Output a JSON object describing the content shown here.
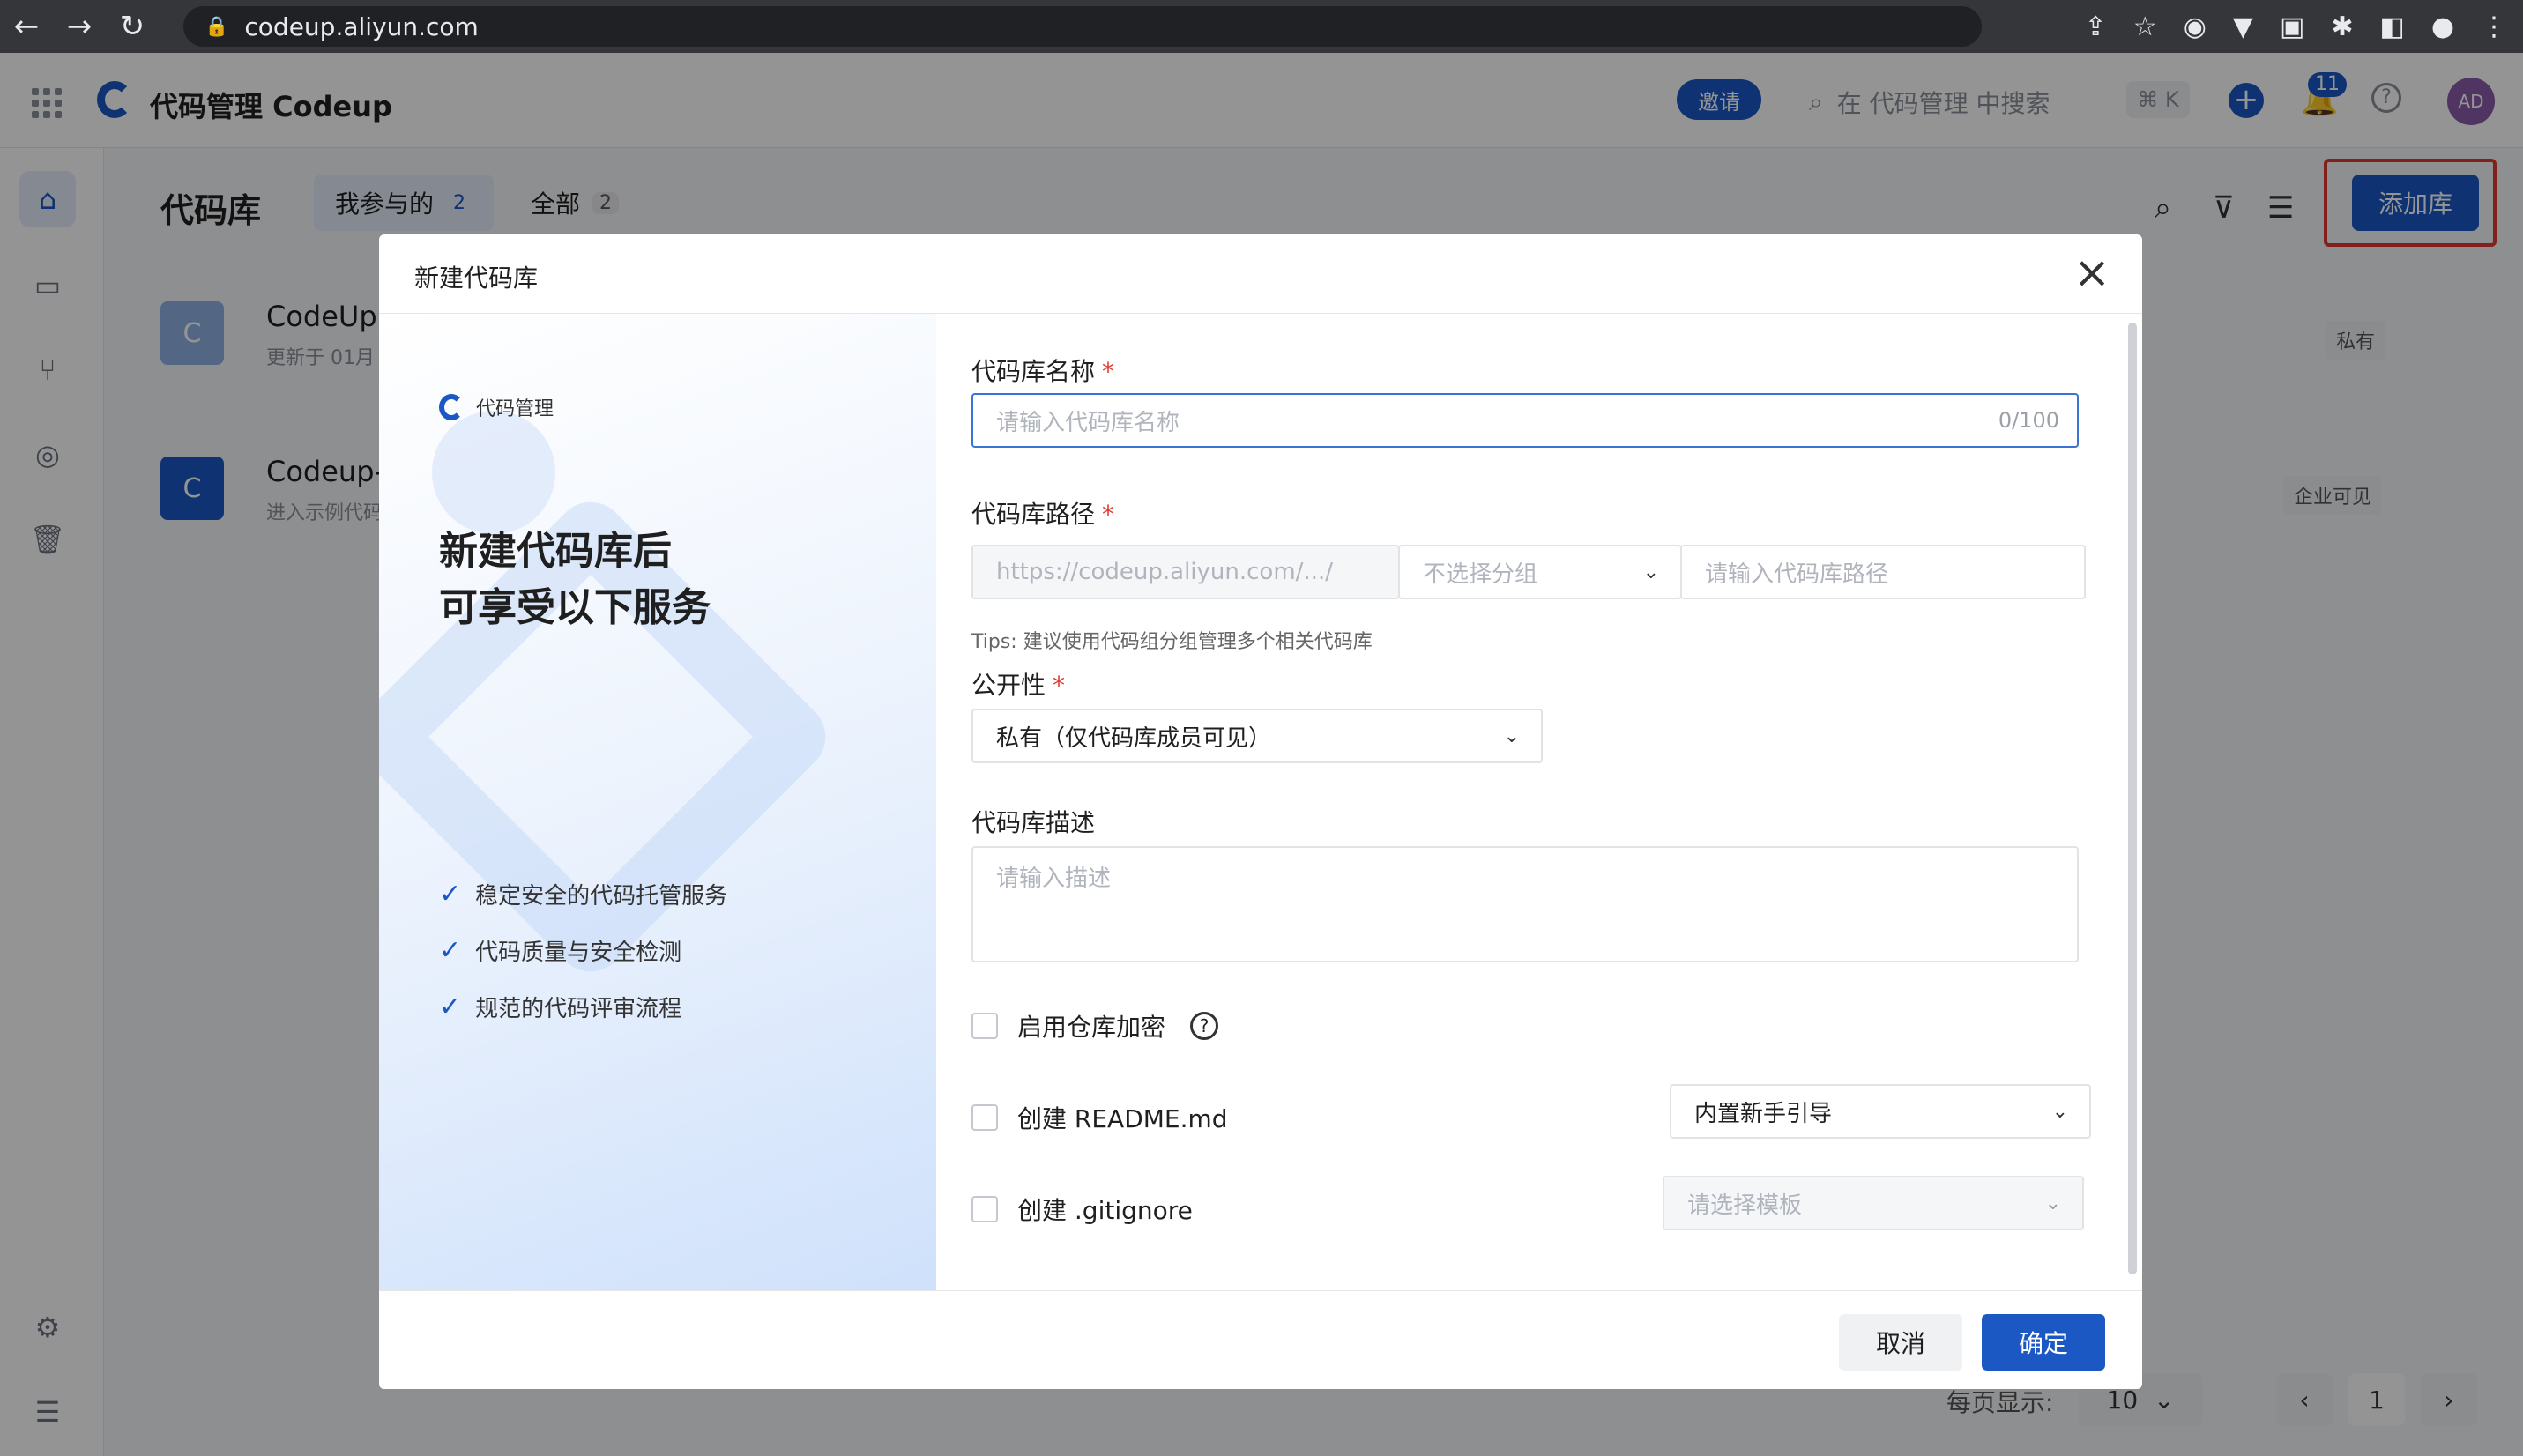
{
  "browser": {
    "url": "codeup.aliyun.com"
  },
  "header": {
    "app_title": "代码管理 Codeup",
    "invite_label": "邀请",
    "search_placeholder": "在 代码管理 中搜索",
    "shortcut": "⌘ K",
    "notification_count": "11",
    "avatar_initials": "AD"
  },
  "page": {
    "title": "代码库",
    "tabs": [
      {
        "label": "我参与的",
        "count": "2"
      },
      {
        "label": "全部",
        "count": "2"
      }
    ],
    "add_repo_label": "添加库",
    "repos": [
      {
        "initial": "C",
        "name": "CodeUpl",
        "sub": "更新于 01月",
        "visibility": "私有"
      },
      {
        "initial": "C",
        "name": "Codeup-",
        "sub": "进入示例代码",
        "visibility": "企业可见"
      }
    ],
    "pager": {
      "per_page_label": "每页显示:",
      "per_page": "10",
      "current": "1"
    }
  },
  "modal": {
    "title": "新建代码库",
    "left": {
      "brand": "代码管理",
      "headline_1": "新建代码库后",
      "headline_2": "可享受以下服务",
      "features": [
        "稳定安全的代码托管服务",
        "代码质量与安全检测",
        "规范的代码评审流程"
      ]
    },
    "form": {
      "name_label": "代码库名称",
      "name_placeholder": "请输入代码库名称",
      "name_count": "0/100",
      "path_label": "代码库路径",
      "path_prefix": "https://codeup.aliyun.com/.../",
      "group_placeholder": "不选择分组",
      "path_placeholder": "请输入代码库路径",
      "tips": "Tips: 建议使用代码组分组管理多个相关代码库",
      "visibility_label": "公开性",
      "visibility_value": "私有（仅代码库成员可见）",
      "desc_label": "代码库描述",
      "desc_placeholder": "请输入描述",
      "encrypt_label": "启用仓库加密",
      "readme_label": "创建 README.md",
      "readme_template": "内置新手引导",
      "gitignore_label": "创建 .gitignore",
      "gitignore_placeholder": "请选择模板"
    },
    "cancel_label": "取消",
    "ok_label": "确定"
  },
  "colors": {
    "primary": "#1b58c4",
    "highlight_box": "#e03a2f"
  }
}
